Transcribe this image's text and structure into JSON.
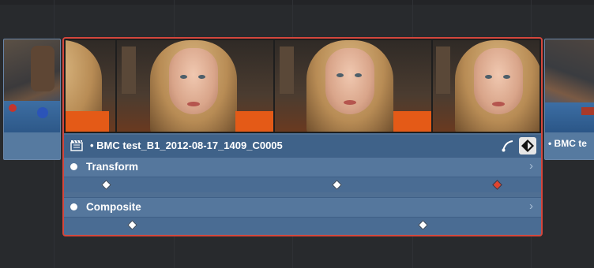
{
  "timeline": {
    "clips": {
      "left": {
        "thumbnail": "billiards-scene-thumbnail"
      },
      "right": {
        "thumbnail": "billiards-scene-thumbnail",
        "name": "• BMC te"
      },
      "selected": {
        "name": "• BMC test_B1_2012-08-17_1409_C0005",
        "clip_icon": "film-clapper-icon",
        "curve_icon": "curve-editor-icon",
        "keyframe_toggle_icon": "keyframe-diamond-toggle-icon",
        "accent_color": "#d4463c",
        "properties": [
          {
            "label": "Transform",
            "expand_icon": "chevron-right-icon",
            "keyframe_count": 3,
            "selected_keyframe": 3,
            "selected_color": "#e0442f"
          },
          {
            "label": "Composite",
            "expand_icon": "chevron-right-icon",
            "keyframe_count": 2
          }
        ]
      }
    }
  }
}
